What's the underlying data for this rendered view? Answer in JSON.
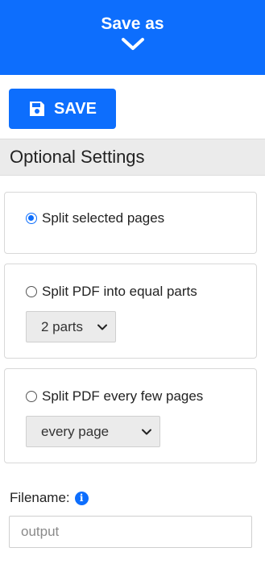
{
  "header": {
    "title": "Save as",
    "chevron_icon": "chevron-down-icon"
  },
  "save_button": {
    "label": "SAVE",
    "icon": "floppy-disk-icon"
  },
  "colors": {
    "accent": "#0d6efd",
    "section_bar": "#ebebeb"
  },
  "optional_settings": {
    "title": "Optional Settings",
    "options": [
      {
        "label": "Split selected pages",
        "checked": true
      },
      {
        "label": "Split PDF into equal parts",
        "checked": false,
        "select_value": "2 parts"
      },
      {
        "label": "Split PDF every few pages",
        "checked": false,
        "select_value": "every page"
      }
    ]
  },
  "filename": {
    "label": "Filename:",
    "info_icon": "info-icon",
    "info_glyph": "i",
    "value": "",
    "placeholder": "output"
  }
}
